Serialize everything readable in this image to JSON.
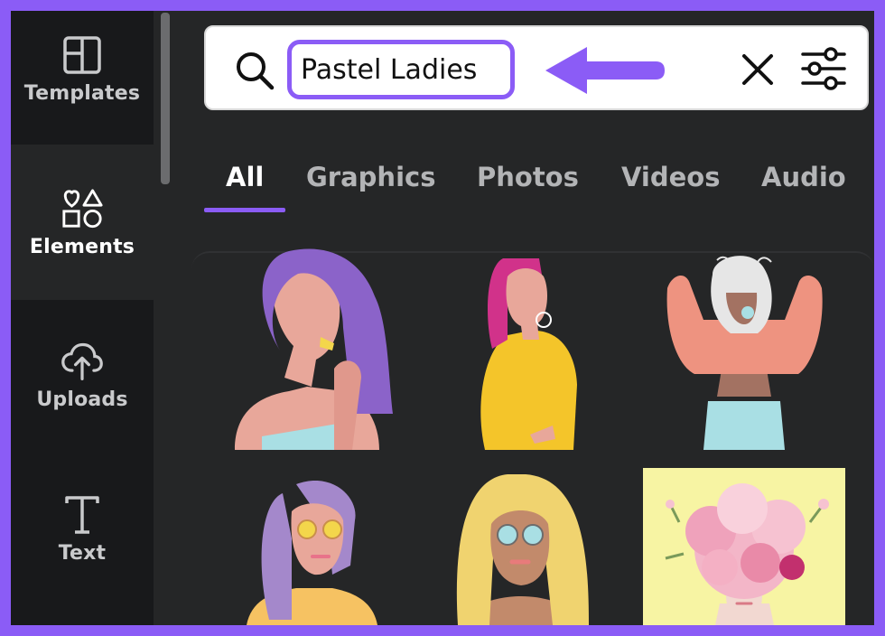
{
  "sidebar": {
    "items": [
      {
        "label": "Templates",
        "icon": "templates-icon"
      },
      {
        "label": "Elements",
        "icon": "elements-icon"
      },
      {
        "label": "Uploads",
        "icon": "upload-cloud-icon"
      },
      {
        "label": "Text",
        "icon": "text-icon"
      }
    ],
    "active": "Elements"
  },
  "search": {
    "value": "Pastel Ladies",
    "icons": [
      "search-icon",
      "arrow-left-icon",
      "close-icon",
      "filter-sliders-icon"
    ]
  },
  "tabs": {
    "items": [
      {
        "label": "All"
      },
      {
        "label": "Graphics"
      },
      {
        "label": "Photos"
      },
      {
        "label": "Videos"
      },
      {
        "label": "Audio"
      }
    ],
    "active": "All"
  },
  "results": {
    "items": [
      {
        "kind": "graphic",
        "subject": "purple-haired woman"
      },
      {
        "kind": "graphic",
        "subject": "pink-haired woman in yellow"
      },
      {
        "kind": "graphic",
        "subject": "white-haired woman blowing gum"
      },
      {
        "kind": "graphic",
        "subject": "lavender-haired woman with sunglasses"
      },
      {
        "kind": "graphic",
        "subject": "blonde woman with sunglasses"
      },
      {
        "kind": "photo",
        "subject": "flowers head portrait"
      }
    ]
  },
  "colors": {
    "accent": "#8b5cf6",
    "background": "#252627",
    "rail": "#18191b"
  }
}
